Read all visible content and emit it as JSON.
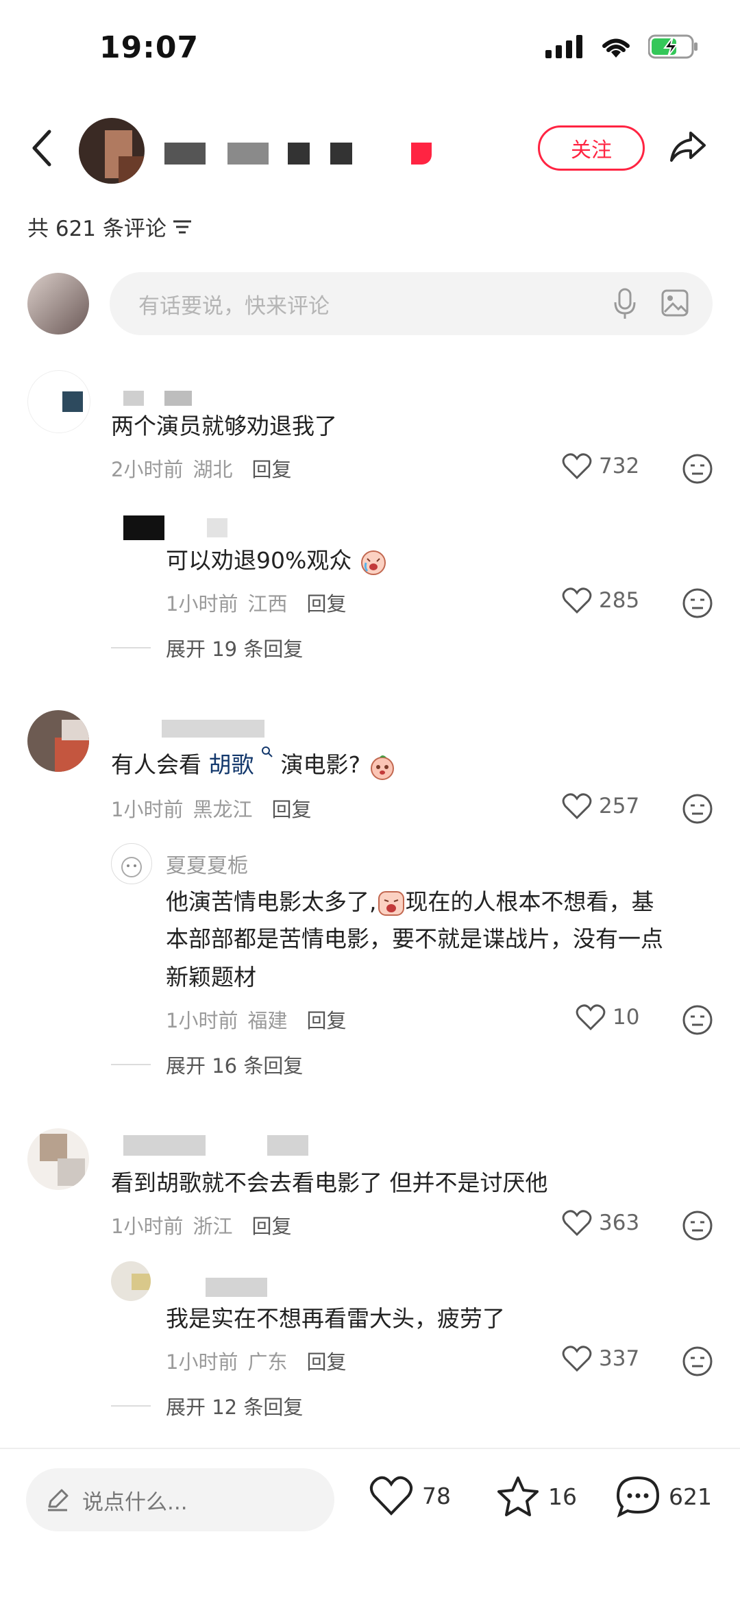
{
  "status_bar": {
    "time": "19:07"
  },
  "header": {
    "follow_label": "关注"
  },
  "comments_header": {
    "count_text": "共 621 条评论"
  },
  "input": {
    "placeholder": "有话要说，快来评论"
  },
  "comments": [
    {
      "text": "两个演员就够劝退我了",
      "time": "2小时前",
      "location": "湖北",
      "reply_label": "回复",
      "likes": "732",
      "replies": [
        {
          "text": "可以劝退90%观众",
          "time": "1小时前",
          "location": "江西",
          "reply_label": "回复",
          "likes": "285"
        }
      ],
      "expand_text": "展开 19 条回复"
    },
    {
      "text_before": "有人会看",
      "highlight": "胡歌",
      "text_after": "演电影?",
      "time": "1小时前",
      "location": "黑龙江",
      "reply_label": "回复",
      "likes": "257",
      "replies": [
        {
          "username": "夏夏夏栀",
          "text_a": "他演苦情电影太多了,",
          "text_b": "现在的人根本不想看，基",
          "text_c": "本部部都是苦情电影，要不就是谍战片，没有一点",
          "text_d": "新颖题材",
          "time": "1小时前",
          "location": "福建",
          "reply_label": "回复",
          "likes": "10"
        }
      ],
      "expand_text": "展开 16 条回复"
    },
    {
      "text": "看到胡歌就不会去看电影了 但并不是讨厌他",
      "time": "1小时前",
      "location": "浙江",
      "reply_label": "回复",
      "likes": "363",
      "replies": [
        {
          "text": "我是实在不想再看雷大头，疲劳了",
          "time": "1小时前",
          "location": "广东",
          "reply_label": "回复",
          "likes": "337"
        }
      ],
      "expand_text": "展开 12 条回复"
    }
  ],
  "bottom_bar": {
    "say_placeholder": "说点什么...",
    "likes": "78",
    "stars": "16",
    "comments": "621"
  },
  "colors": {
    "accent": "#ff2442",
    "mention": "#13386c"
  }
}
